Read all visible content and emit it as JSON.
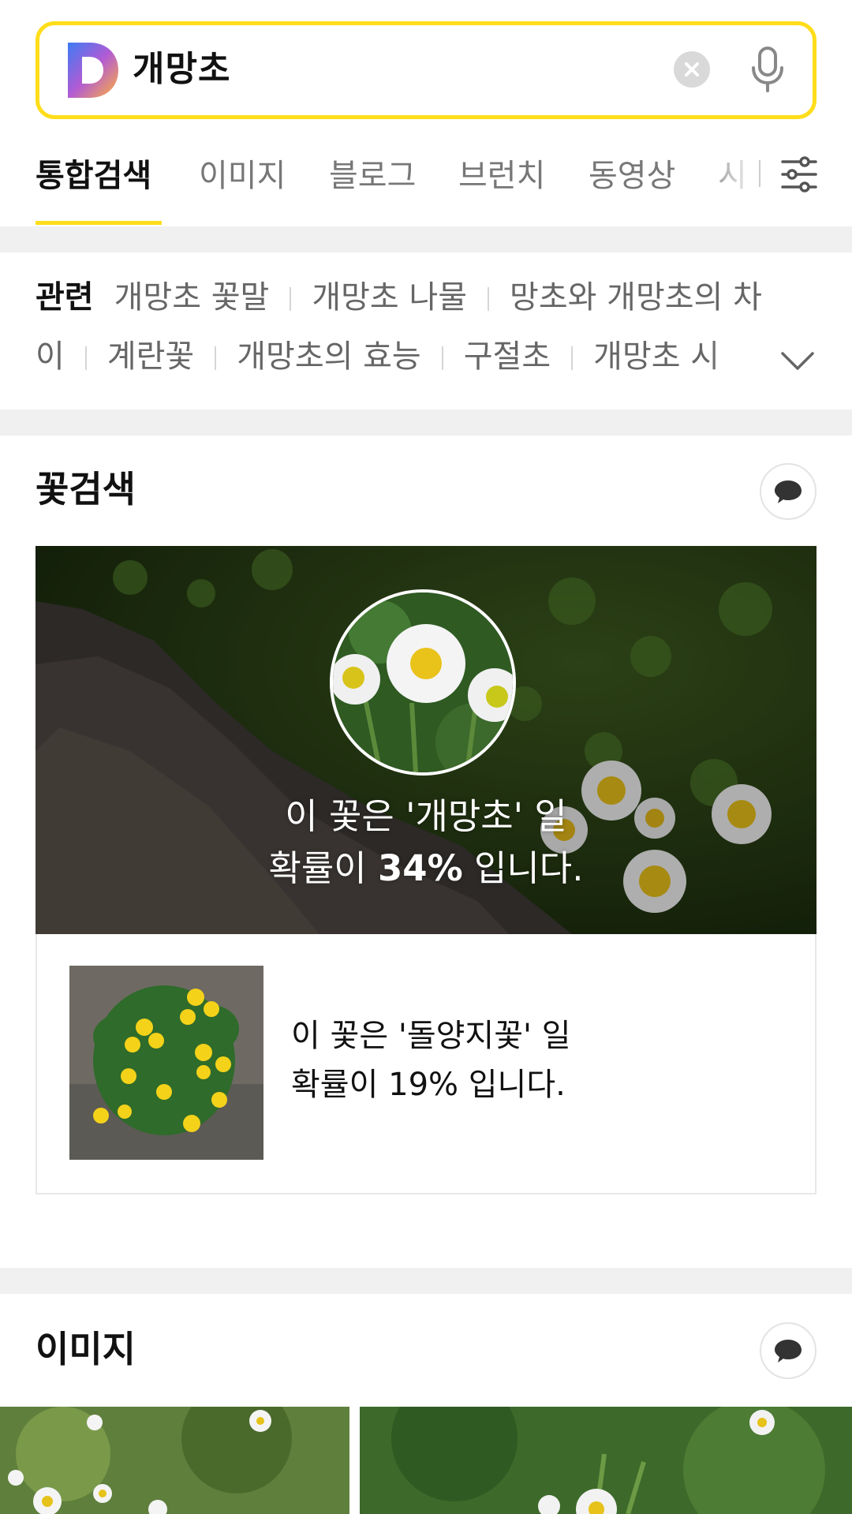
{
  "search": {
    "query": "개망초"
  },
  "tabs": [
    {
      "label": "통합검색",
      "active": true
    },
    {
      "label": "이미지"
    },
    {
      "label": "블로그"
    },
    {
      "label": "브런치"
    },
    {
      "label": "동영상"
    },
    {
      "label": "시"
    }
  ],
  "related": {
    "lead": "관련",
    "row1": [
      "개망초 꽃말",
      "개망초 나물",
      "망초와 개망초의 차"
    ],
    "row2": [
      "이",
      "계란꽃",
      "개망초의 효능",
      "구절초",
      "개망초 시"
    ]
  },
  "flower_search": {
    "title": "꽃검색",
    "top": {
      "line1": "이 꽃은 '개망초' 일",
      "prefix": "확률이 ",
      "percent": "34%",
      "suffix": " 입니다."
    },
    "second": {
      "line1": "이 꽃은 '돌양지꽃' 일",
      "line2": "확률이 19% 입니다."
    }
  },
  "images": {
    "title": "이미지"
  },
  "colors": {
    "accent": "#ffdd1a",
    "logo_blue": "#4f6ef7",
    "logo_orange": "#f79a3b"
  },
  "icons": [
    "d-logo-icon",
    "clear-icon",
    "mic-icon",
    "filter-icon",
    "chevron-down-icon",
    "chat-bubble-icon"
  ]
}
